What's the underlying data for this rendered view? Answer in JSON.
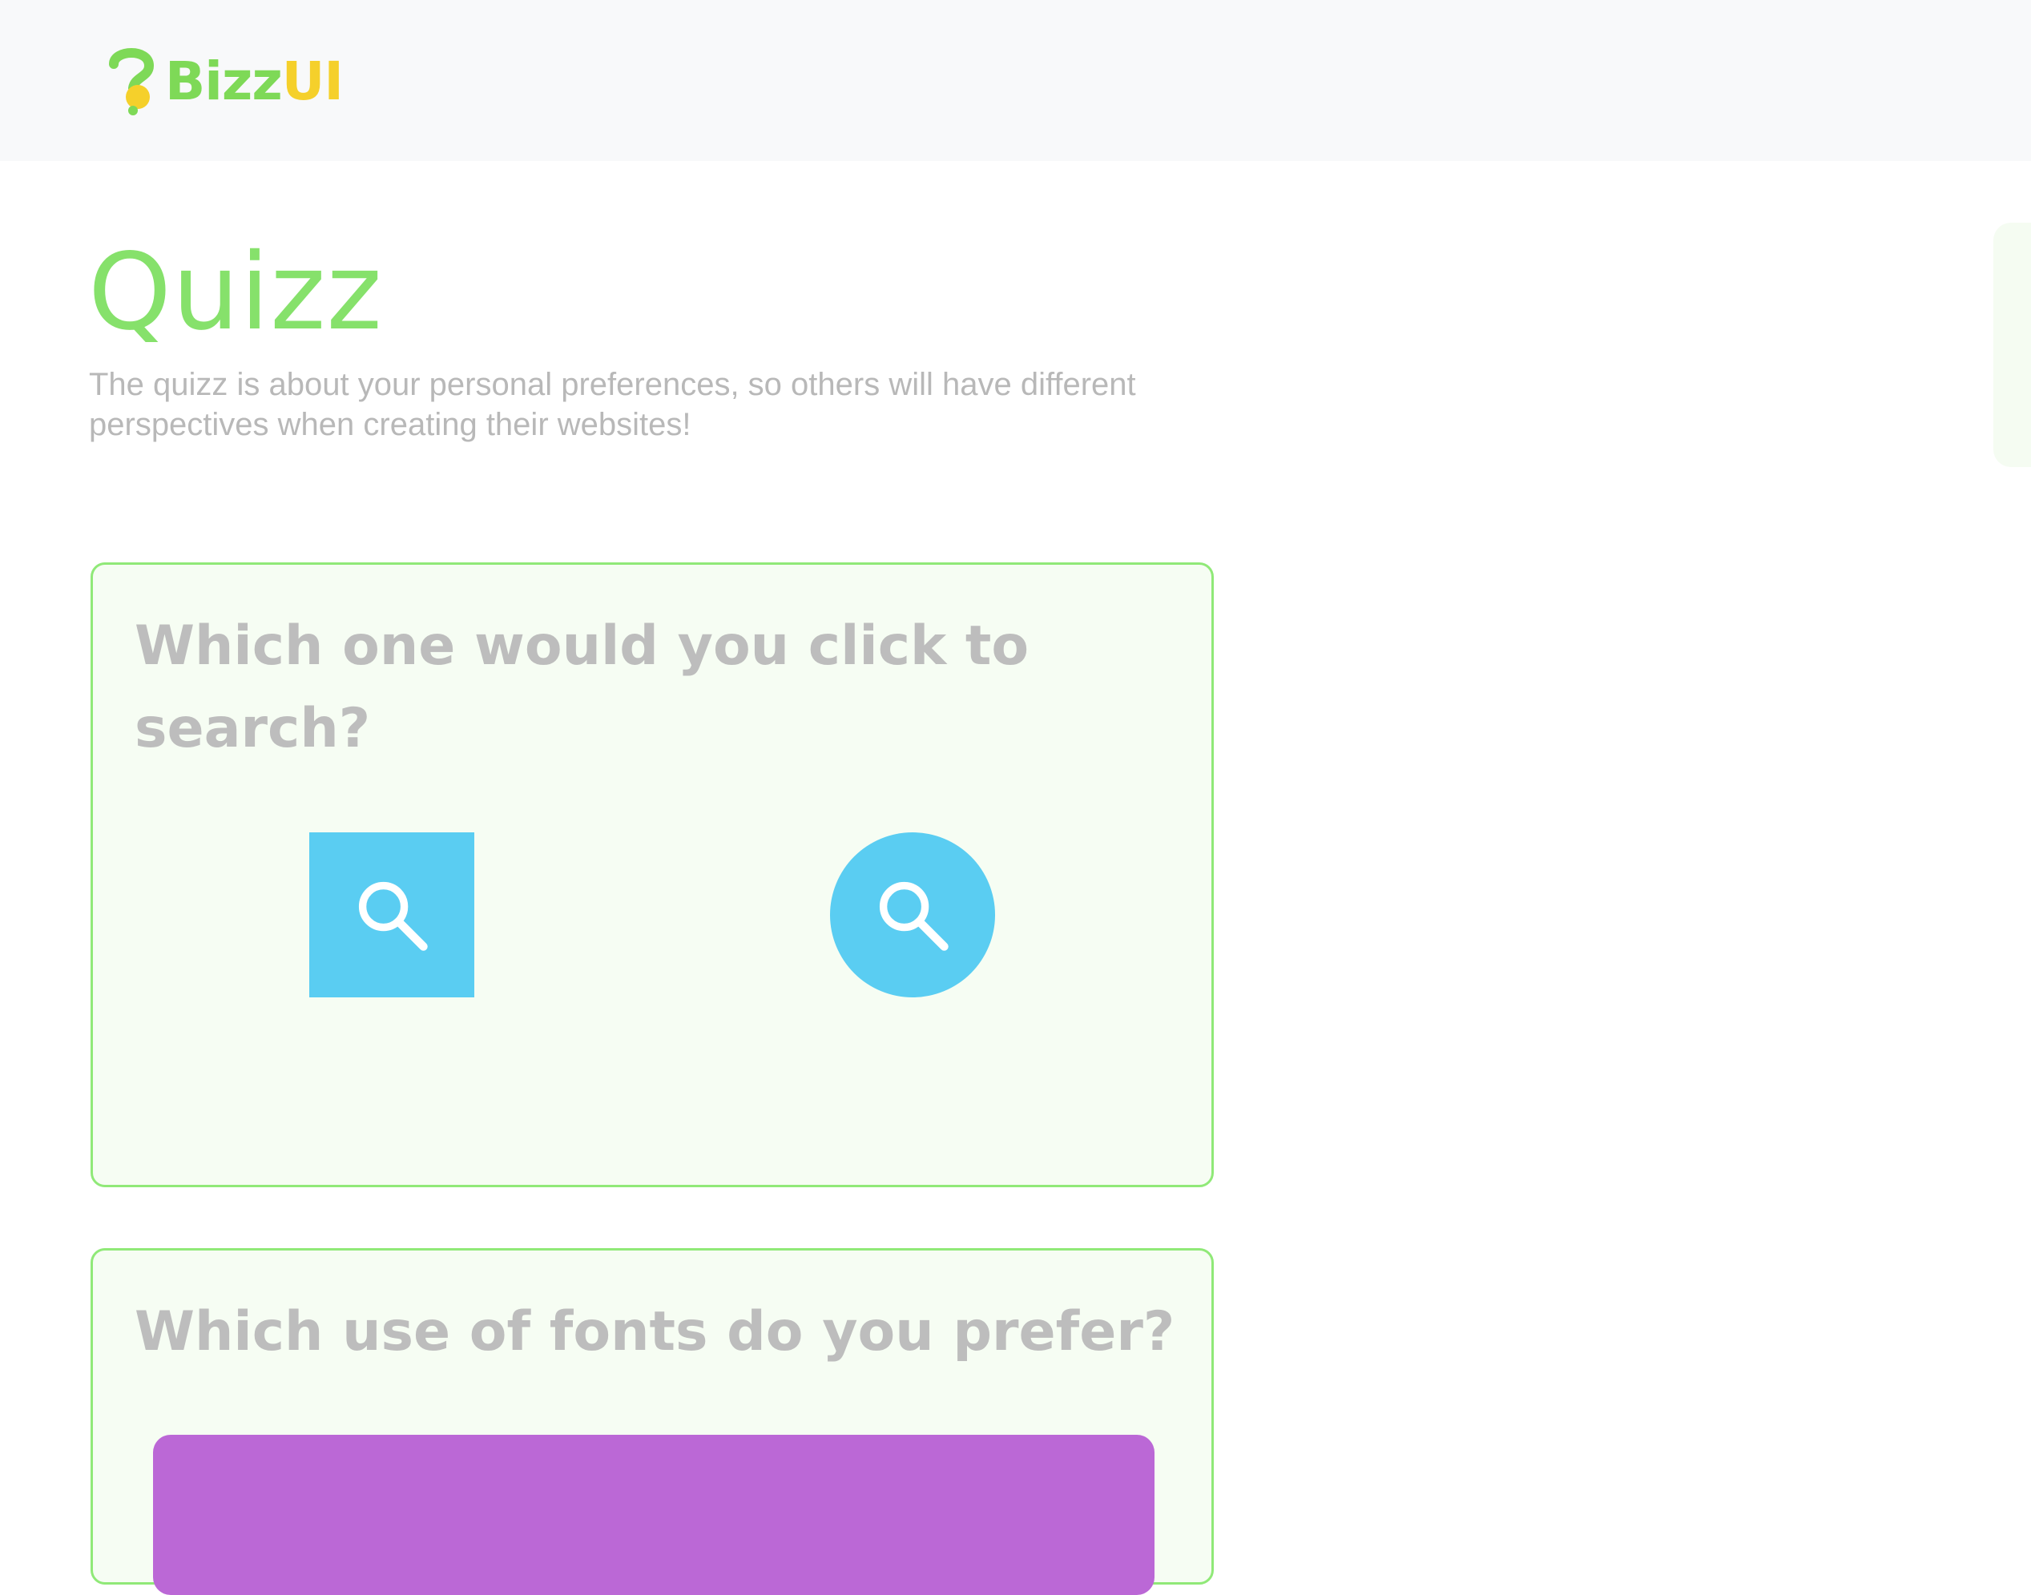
{
  "brand": {
    "name_part1": "Bizz",
    "name_part2": "UI",
    "colors": {
      "green": "#7ed957",
      "yellow": "#f5d02b"
    }
  },
  "page": {
    "title": "Quizz",
    "subtitle": "The quizz is about your personal preferences, so others will have different perspectives when creating their websites!"
  },
  "questions": [
    {
      "text": "Which one would you click to search?",
      "options": [
        {
          "shape": "square",
          "icon": "search-icon",
          "color": "#5acdf2"
        },
        {
          "shape": "circle",
          "icon": "search-icon",
          "color": "#5acdf2"
        }
      ]
    },
    {
      "text": "Which use of fonts do you prefer?",
      "options": [
        {
          "color": "#bb68d6"
        }
      ]
    }
  ],
  "colors": {
    "accent_green": "#86e16b",
    "card_border": "#90e978",
    "card_background": "#f6fdf3",
    "muted_text": "#b8b8b8",
    "header_background": "#f8f9fa"
  }
}
